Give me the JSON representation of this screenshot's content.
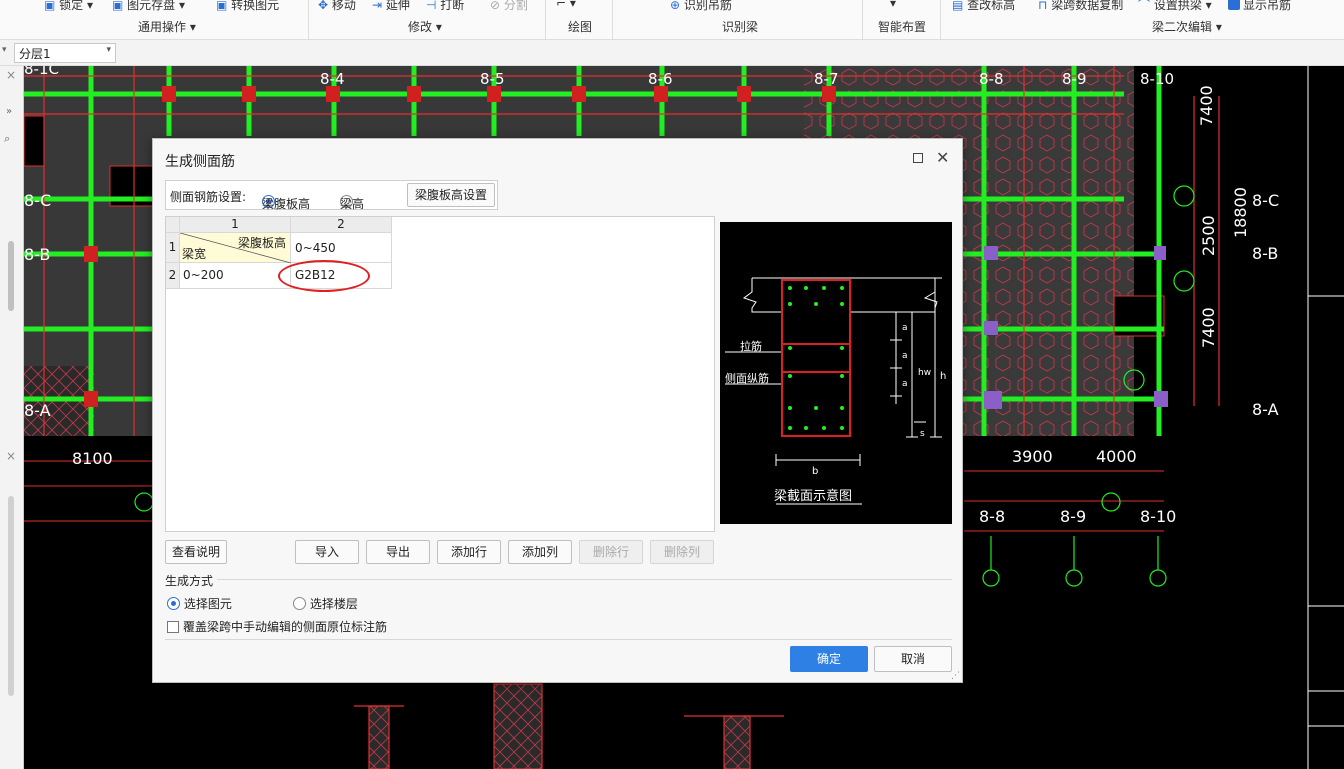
{
  "ribbon": {
    "top_items": [
      "锁定",
      "图元存盘",
      "转换图元",
      "移动",
      "延伸",
      "打断",
      "分割",
      "识别吊筋",
      "查改标高",
      "梁跨数据复制",
      "设置拱梁",
      "显示吊筋"
    ],
    "groups": [
      "通用操作",
      "修改",
      "绘图",
      "识别梁",
      "智能布置",
      "梁二次编辑"
    ]
  },
  "layer_select": {
    "value": "分层1"
  },
  "drawing": {
    "axis_labels": [
      "8-1C",
      "8-4",
      "8-5",
      "8-6",
      "8-7",
      "8-8",
      "8-9",
      "8-10",
      "8-C",
      "8-B",
      "8-A",
      "8-C",
      "8-B",
      "8-A",
      "8-8",
      "8-9",
      "8-10"
    ],
    "dims": [
      "7400",
      "7400",
      "18800",
      "2500",
      "8100",
      "3900",
      "4000"
    ]
  },
  "dialog": {
    "title": "生成侧面筋",
    "settings_label": "侧面钢筋设置:",
    "radio_web_height": "梁腹板高",
    "radio_beam_height": "梁高",
    "web_height_setting_button": "梁腹板高设置",
    "grid": {
      "col_headers": [
        "1",
        "2"
      ],
      "row_headers": [
        "1",
        "2"
      ],
      "corner_top": "梁腹板高",
      "corner_bottom": "梁宽",
      "row1_value": "0~450",
      "row2_label": "0~200",
      "row2_value": "G2B12"
    },
    "preview": {
      "caption": "梁截面示意图",
      "label_tie": "拉筋",
      "label_side": "侧面纵筋",
      "label_a": "a",
      "label_hw": "hw",
      "label_h": "h",
      "label_s": "s",
      "label_b": "b"
    },
    "buttons": {
      "help": "查看说明",
      "import": "导入",
      "export": "导出",
      "add_row": "添加行",
      "add_col": "添加列",
      "del_row": "删除行",
      "del_col": "删除列",
      "ok": "确定",
      "cancel": "取消"
    },
    "gen_mode_label": "生成方式",
    "opt_select_element": "选择图元",
    "opt_select_floor": "选择楼层",
    "override_label": "覆盖梁跨中手动编辑的侧面原位标注筋"
  },
  "colors": {
    "accent": "#2f80e4",
    "highlight_circle": "#e02020",
    "beam_green": "#22ee22",
    "column_magenta": "#9060c0"
  }
}
